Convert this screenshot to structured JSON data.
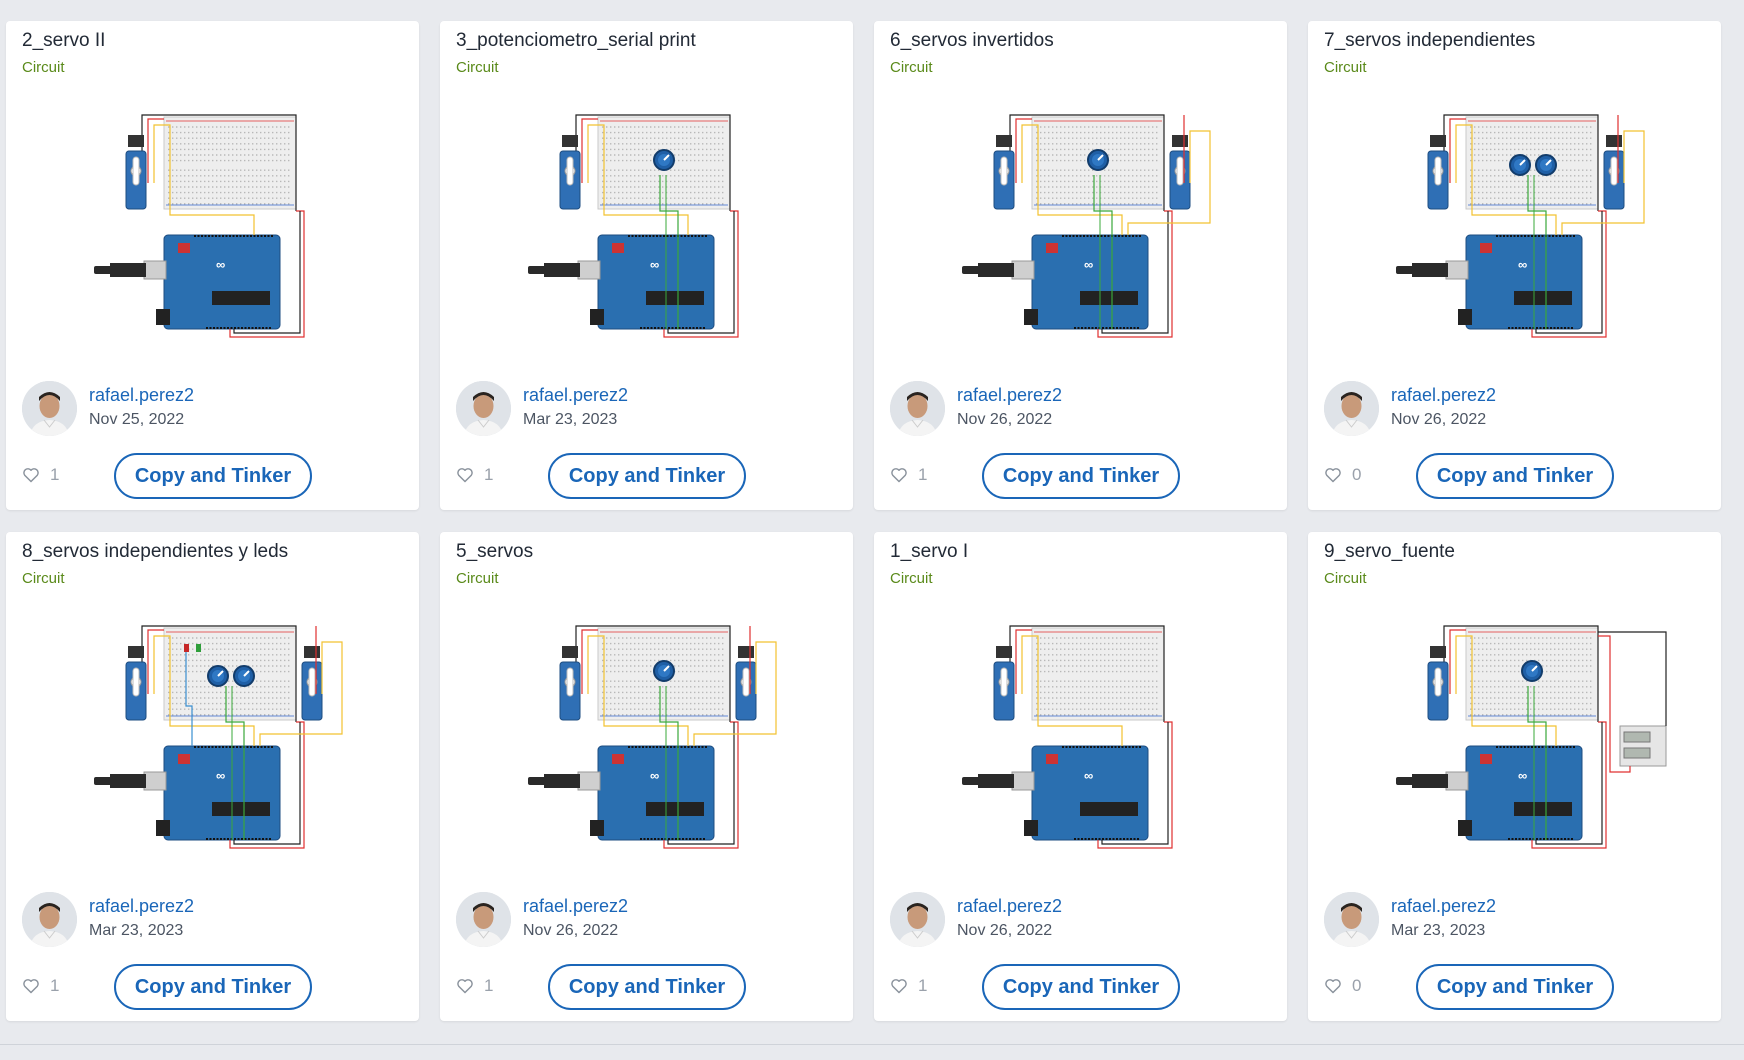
{
  "cards": [
    {
      "title": "2_servo II",
      "type": "Circuit",
      "author": "rafael.perez2",
      "date": "Nov 25, 2022",
      "likes": "1",
      "button": "Copy and Tinker",
      "pots": 0,
      "servos": 1,
      "leds": false,
      "supply": false
    },
    {
      "title": "3_potenciometro_serial print",
      "type": "Circuit",
      "author": "rafael.perez2",
      "date": "Mar 23, 2023",
      "likes": "1",
      "button": "Copy and Tinker",
      "pots": 1,
      "servos": 1,
      "leds": false,
      "supply": false
    },
    {
      "title": "6_servos invertidos",
      "type": "Circuit",
      "author": "rafael.perez2",
      "date": "Nov 26, 2022",
      "likes": "1",
      "button": "Copy and Tinker",
      "pots": 1,
      "servos": 2,
      "leds": false,
      "supply": false
    },
    {
      "title": "7_servos independientes",
      "type": "Circuit",
      "author": "rafael.perez2",
      "date": "Nov 26, 2022",
      "likes": "0",
      "button": "Copy and Tinker",
      "pots": 2,
      "servos": 2,
      "leds": false,
      "supply": false
    },
    {
      "title": "8_servos independientes y leds",
      "type": "Circuit",
      "author": "rafael.perez2",
      "date": "Mar 23, 2023",
      "likes": "1",
      "button": "Copy and Tinker",
      "pots": 2,
      "servos": 2,
      "leds": true,
      "supply": false
    },
    {
      "title": "5_servos",
      "type": "Circuit",
      "author": "rafael.perez2",
      "date": "Nov 26, 2022",
      "likes": "1",
      "button": "Copy and Tinker",
      "pots": 1,
      "servos": 2,
      "leds": false,
      "supply": false
    },
    {
      "title": "1_servo I",
      "type": "Circuit",
      "author": "rafael.perez2",
      "date": "Nov 26, 2022",
      "likes": "1",
      "button": "Copy and Tinker",
      "pots": 0,
      "servos": 1,
      "leds": false,
      "supply": false
    },
    {
      "title": "9_servo_fuente",
      "type": "Circuit",
      "author": "rafael.perez2",
      "date": "Mar 23, 2023",
      "likes": "0",
      "button": "Copy and Tinker",
      "pots": 1,
      "servos": 1,
      "leds": false,
      "supply": true
    }
  ],
  "colors": {
    "board": "#2a6fb0",
    "breadboard": "#eeeeee",
    "wire_red": "#e03030",
    "wire_yellow": "#f2c230",
    "wire_black": "#222222",
    "wire_green": "#3aa83a",
    "link": "#1a66b8",
    "type_label": "#5a8a1a"
  },
  "icons": {
    "like": "heart-outline-icon"
  }
}
